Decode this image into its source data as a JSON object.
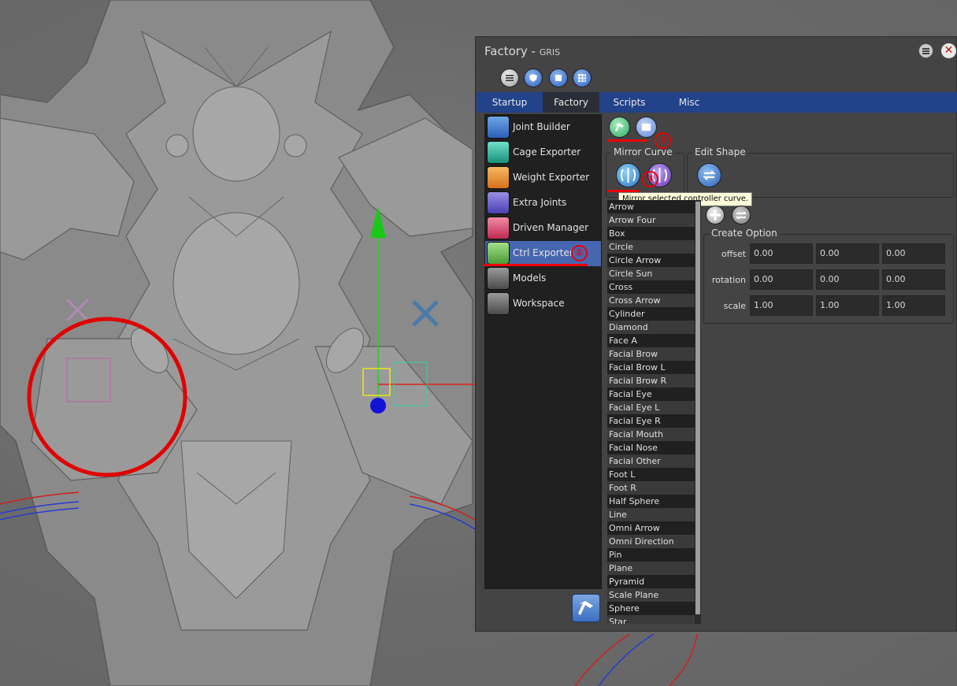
{
  "window": {
    "title": "Factory - ",
    "subtitle": "GRIS"
  },
  "tabs": [
    {
      "label": "Startup"
    },
    {
      "label": "Factory"
    },
    {
      "label": "Scripts"
    },
    {
      "label": "Misc"
    }
  ],
  "modules": [
    {
      "label": "Joint Builder"
    },
    {
      "label": "Cage Exporter"
    },
    {
      "label": "Weight Exporter"
    },
    {
      "label": "Extra Joints"
    },
    {
      "label": "Driven Manager"
    },
    {
      "label": "Ctrl Exporter"
    },
    {
      "label": "Models"
    },
    {
      "label": "Workspace"
    }
  ],
  "groups": {
    "mirror": "Mirror Curve",
    "edit": "Edit Shape",
    "create": "Create Option"
  },
  "tooltip": "Mirror selected controller curve.",
  "curves": [
    "Arrow",
    "Arrow Four",
    "Box",
    "Circle",
    "Circle Arrow",
    "Circle Sun",
    "Cross",
    "Cross Arrow",
    "Cylinder",
    "Diamond",
    "Face A",
    "Facial Brow",
    "Facial Brow L",
    "Facial Brow R",
    "Facial Eye",
    "Facial Eye L",
    "Facial Eye R",
    "Facial Mouth",
    "Facial Nose",
    "Facial Other",
    "Foot L",
    "Foot R",
    "Half Sphere",
    "Line",
    "Omni Arrow",
    "Omni Direction",
    "Pin",
    "Plane",
    "Pyramid",
    "Scale Plane",
    "Sphere",
    "Star"
  ],
  "create_option": {
    "offset": {
      "label": "offset",
      "values": [
        "0.00",
        "0.00",
        "0.00"
      ]
    },
    "rotation": {
      "label": "rotation",
      "values": [
        "0.00",
        "0.00",
        "0.00"
      ]
    },
    "scale": {
      "label": "scale",
      "values": [
        "1.00",
        "1.00",
        "1.00"
      ]
    }
  },
  "annotations": [
    "①",
    "②",
    "③"
  ],
  "colors": {
    "tab_bar": "#22428a",
    "selected": "#4766b0",
    "annotation": "#e00000"
  }
}
